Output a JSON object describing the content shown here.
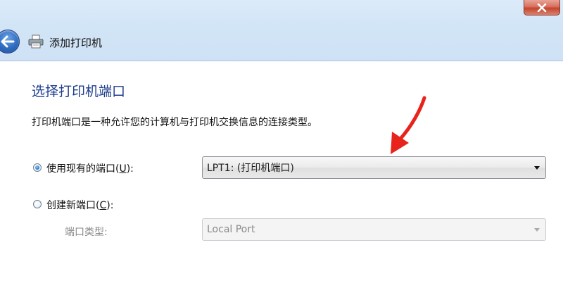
{
  "window": {
    "title": "添加打印机",
    "close_icon": "close-icon",
    "back_icon": "back-arrow-icon",
    "printer_icon": "printer-icon"
  },
  "page": {
    "heading": "选择打印机端口",
    "description": "打印机端口是一种允许您的计算机与打印机交换信息的连接类型。"
  },
  "options": {
    "use_existing": {
      "label_prefix": "使用现有的端口(",
      "hotkey": "U",
      "label_suffix": "):",
      "selected": true,
      "dropdown_value": "LPT1: (打印机端口)"
    },
    "create_new": {
      "label_prefix": "创建新端口(",
      "hotkey": "C",
      "label_suffix": "):",
      "selected": false,
      "port_type_label": "端口类型:",
      "port_type_value": "Local Port"
    }
  },
  "colors": {
    "heading": "#1e3d8f",
    "annotation_arrow": "#e8231b",
    "close_button": "#c4442d"
  }
}
